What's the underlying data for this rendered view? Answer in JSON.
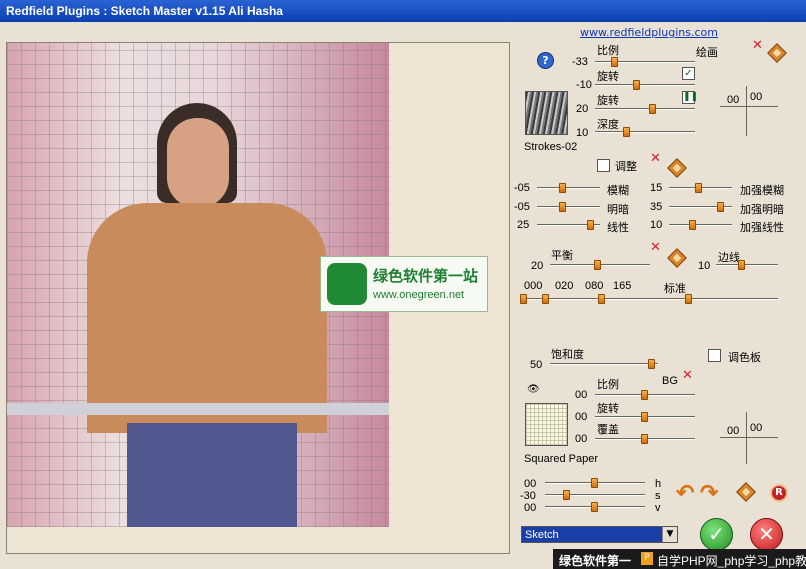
{
  "window": {
    "title": "Redfield Plugins : Sketch Master v1.15   Ali Hasha"
  },
  "header": {
    "link": "www.redfieldplugins.com"
  },
  "section1": {
    "scale_label": "比例",
    "scale_value": "-33",
    "paint_label": "绘画",
    "rotate1_label": "旋转",
    "rotate1_value": "-10",
    "rotate2_label": "旋转",
    "rotate2_value": "20",
    "depth_label": "深度",
    "depth_value": "10",
    "stroke_name": "Strokes-02",
    "cross_x": "00",
    "cross_y": "00"
  },
  "adjust": {
    "checkbox_label": "调整",
    "rows": [
      {
        "lv": "-05",
        "ll": "模糊",
        "rv": "15",
        "rl": "加强模糊"
      },
      {
        "lv": "-05",
        "ll": "明暗",
        "rv": "35",
        "rl": "加强明暗"
      },
      {
        "lv": "25",
        "ll": "线性",
        "rv": "10",
        "rl": "加强线性"
      }
    ]
  },
  "balance": {
    "label": "平衡",
    "value": "20",
    "edge_label": "边线",
    "edge_value": "10",
    "levels": [
      "000",
      "020",
      "080",
      "165"
    ],
    "standard_label": "标准"
  },
  "saturation": {
    "label": "饱和度",
    "value": "50",
    "palette_label": "调色板"
  },
  "bg": {
    "title": "BG",
    "scale_label": "比例",
    "scale_value": "00",
    "rotate_label": "旋转",
    "rotate_value": "00",
    "cover_label": "覆盖",
    "cover_value": "00",
    "paper_name": "Squared Paper",
    "cross_x": "00",
    "cross_y": "00"
  },
  "hsv": [
    {
      "v": "00",
      "k": "h"
    },
    {
      "v": "-30",
      "k": "s"
    },
    {
      "v": "00",
      "k": "v"
    }
  ],
  "mode": {
    "selected": "Sketch"
  },
  "watermark": {
    "line1": "绿色软件第一站",
    "line2": "www.onegreen.net"
  },
  "bottom_bar": {
    "left": "绿色软件第一",
    "right": "自学PHP网_php学习_php教"
  }
}
